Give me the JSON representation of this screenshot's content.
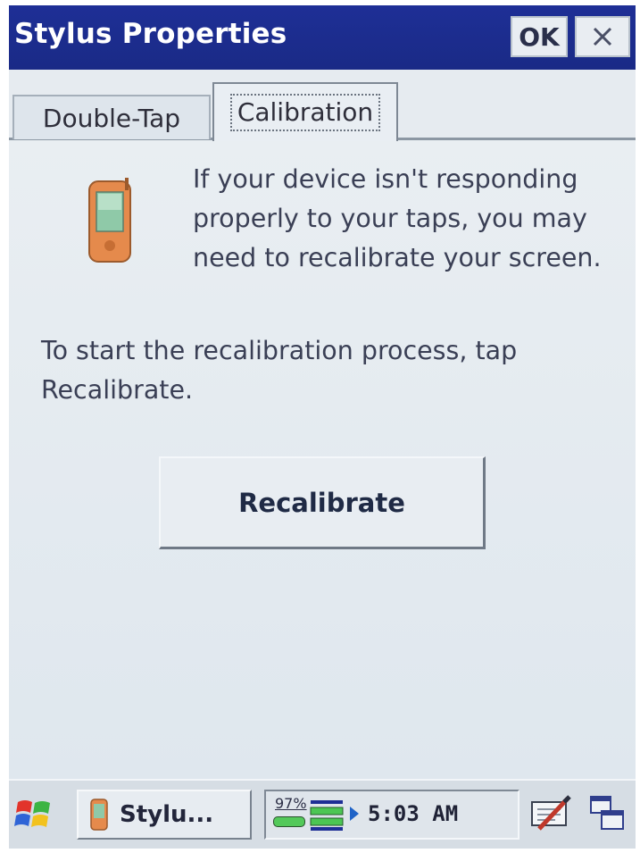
{
  "window": {
    "title": "Stylus Properties",
    "ok_label": "OK",
    "close_icon": "close-icon"
  },
  "tabs": [
    {
      "label": "Double-Tap",
      "selected": false
    },
    {
      "label": "Calibration",
      "selected": true
    }
  ],
  "content": {
    "icon": "pda-device-icon",
    "intro_text": "If your device isn't responding properly to your taps, you may need to recalibrate your screen.",
    "instruction_text": "To start the recalibration process, tap Recalibrate.",
    "recalibrate_label": "Recalibrate"
  },
  "taskbar": {
    "start_icon": "windows-flag-icon",
    "task_label": "Stylu...",
    "battery_percent": "97%",
    "time": "5:03 AM",
    "sip_icon": "input-panel-icon",
    "windows_icon": "switch-windows-icon"
  },
  "colors": {
    "titlebar": "#1e2f96",
    "background": "#dfe6ec",
    "text": "#3a3f55"
  }
}
